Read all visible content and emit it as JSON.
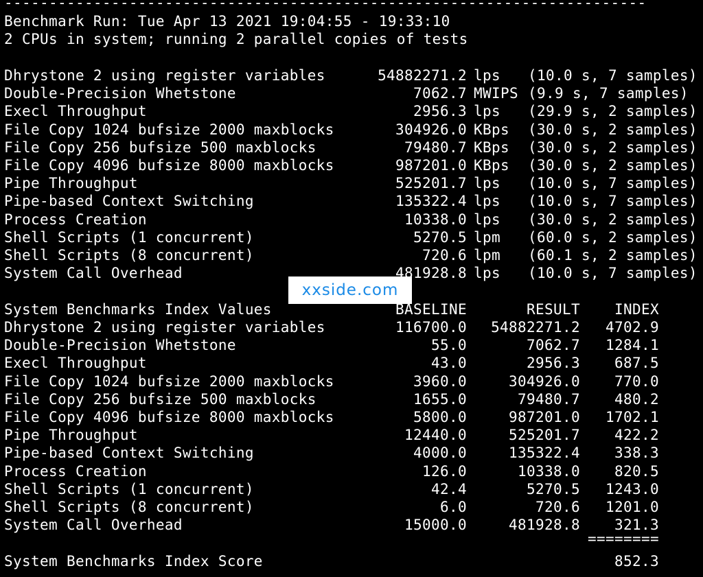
{
  "header": {
    "separator": "------------------------------------------------------------------------",
    "run_line": "Benchmark Run: Tue Apr 13 2021 19:04:55 - 19:33:10",
    "cpu_line": "2 CPUs in system; running 2 parallel copies of tests"
  },
  "results": [
    {
      "name": "Dhrystone 2 using register variables",
      "value": "54882271.2",
      "unit": "lps",
      "detail": "(10.0 s, 7 samples)"
    },
    {
      "name": "Double-Precision Whetstone",
      "value": "7062.7",
      "unit": "MWIPS",
      "detail": "(9.9 s, 7 samples)"
    },
    {
      "name": "Execl Throughput",
      "value": "2956.3",
      "unit": "lps",
      "detail": "(29.9 s, 2 samples)"
    },
    {
      "name": "File Copy 1024 bufsize 2000 maxblocks",
      "value": "304926.0",
      "unit": "KBps",
      "detail": "(30.0 s, 2 samples)"
    },
    {
      "name": "File Copy 256 bufsize 500 maxblocks",
      "value": "79480.7",
      "unit": "KBps",
      "detail": "(30.0 s, 2 samples)"
    },
    {
      "name": "File Copy 4096 bufsize 8000 maxblocks",
      "value": "987201.0",
      "unit": "KBps",
      "detail": "(30.0 s, 2 samples)"
    },
    {
      "name": "Pipe Throughput",
      "value": "525201.7",
      "unit": "lps",
      "detail": "(10.0 s, 7 samples)"
    },
    {
      "name": "Pipe-based Context Switching",
      "value": "135322.4",
      "unit": "lps",
      "detail": "(10.0 s, 7 samples)"
    },
    {
      "name": "Process Creation",
      "value": "10338.0",
      "unit": "lps",
      "detail": "(30.0 s, 2 samples)"
    },
    {
      "name": "Shell Scripts (1 concurrent)",
      "value": "5270.5",
      "unit": "lpm",
      "detail": "(60.0 s, 2 samples)"
    },
    {
      "name": "Shell Scripts (8 concurrent)",
      "value": "720.6",
      "unit": "lpm",
      "detail": "(60.1 s, 2 samples)"
    },
    {
      "name": "System Call Overhead",
      "value": "481928.8",
      "unit": "lps",
      "detail": "(10.0 s, 7 samples)"
    }
  ],
  "index_table": {
    "title": "System Benchmarks Index Values",
    "col_baseline": "BASELINE",
    "col_result": "RESULT",
    "col_index": "INDEX",
    "rows": [
      {
        "name": "Dhrystone 2 using register variables",
        "baseline": "116700.0",
        "result": "54882271.2",
        "index": "4702.9"
      },
      {
        "name": "Double-Precision Whetstone",
        "baseline": "55.0",
        "result": "7062.7",
        "index": "1284.1"
      },
      {
        "name": "Execl Throughput",
        "baseline": "43.0",
        "result": "2956.3",
        "index": "687.5"
      },
      {
        "name": "File Copy 1024 bufsize 2000 maxblocks",
        "baseline": "3960.0",
        "result": "304926.0",
        "index": "770.0"
      },
      {
        "name": "File Copy 256 bufsize 500 maxblocks",
        "baseline": "1655.0",
        "result": "79480.7",
        "index": "480.2"
      },
      {
        "name": "File Copy 4096 bufsize 8000 maxblocks",
        "baseline": "5800.0",
        "result": "987201.0",
        "index": "1702.1"
      },
      {
        "name": "Pipe Throughput",
        "baseline": "12440.0",
        "result": "525201.7",
        "index": "422.2"
      },
      {
        "name": "Pipe-based Context Switching",
        "baseline": "4000.0",
        "result": "135322.4",
        "index": "338.3"
      },
      {
        "name": "Process Creation",
        "baseline": "126.0",
        "result": "10338.0",
        "index": "820.5"
      },
      {
        "name": "Shell Scripts (1 concurrent)",
        "baseline": "42.4",
        "result": "5270.5",
        "index": "1243.0"
      },
      {
        "name": "Shell Scripts (8 concurrent)",
        "baseline": "6.0",
        "result": "720.6",
        "index": "1201.0"
      },
      {
        "name": "System Call Overhead",
        "baseline": "15000.0",
        "result": "481928.8",
        "index": "321.3"
      }
    ],
    "rule": "========",
    "score_label": "System Benchmarks Index Score",
    "score_value": "852.3"
  },
  "watermark": {
    "text": "xxside.com",
    "color": "#1a8ae6"
  }
}
